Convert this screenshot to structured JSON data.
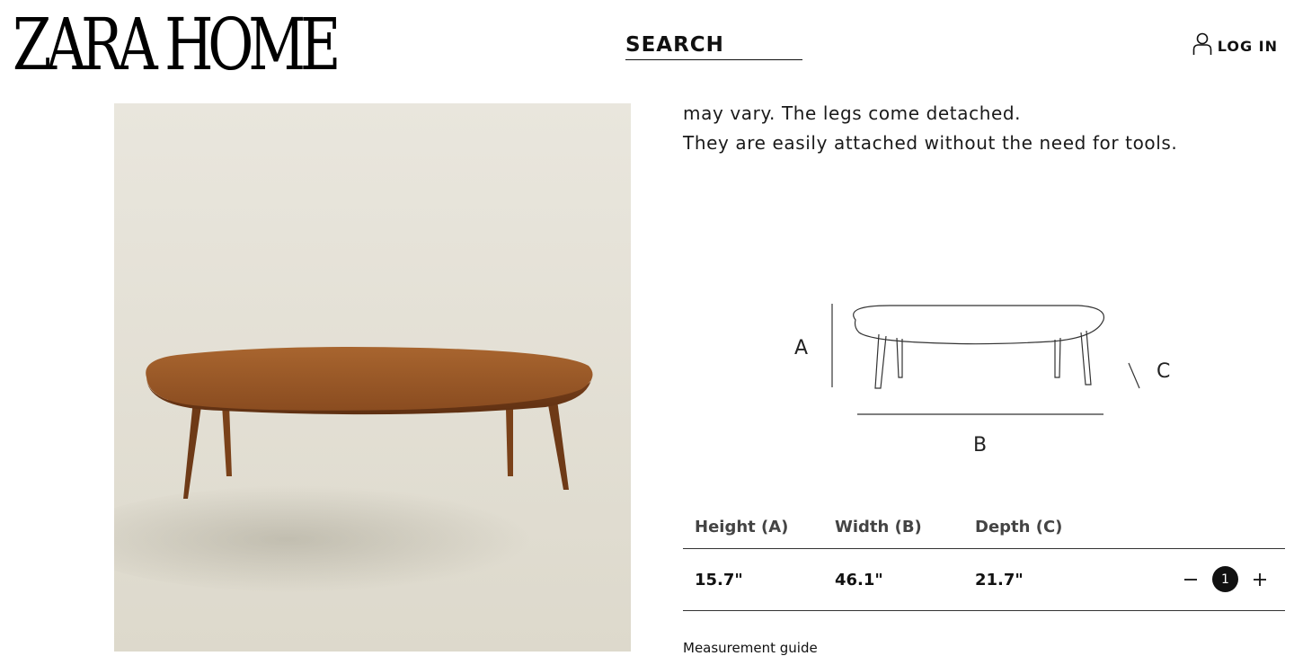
{
  "header": {
    "logo_text": "ZARA HOME",
    "search_label": "SEARCH",
    "login_label": "LOG IN",
    "login_icon": "user-icon"
  },
  "product": {
    "description_lines": [
      "may vary. The legs come detached.",
      "They are easily attached without the need for tools."
    ],
    "diagram": {
      "label_a": "A",
      "label_b": "B",
      "label_c": "C"
    },
    "dimensions": {
      "headers": [
        "Height (A)",
        "Width (B)",
        "Depth (C)"
      ],
      "values": [
        "15.7\"",
        "46.1\"",
        "21.7\""
      ]
    },
    "quantity": {
      "value": "1",
      "minus_icon": "minus-icon",
      "plus_icon": "plus-icon"
    },
    "measurement_guide_label": "Measurement guide"
  },
  "colors": {
    "image_bg": "#e8e4da",
    "wood": "#8b4f24",
    "text": "#111111"
  }
}
